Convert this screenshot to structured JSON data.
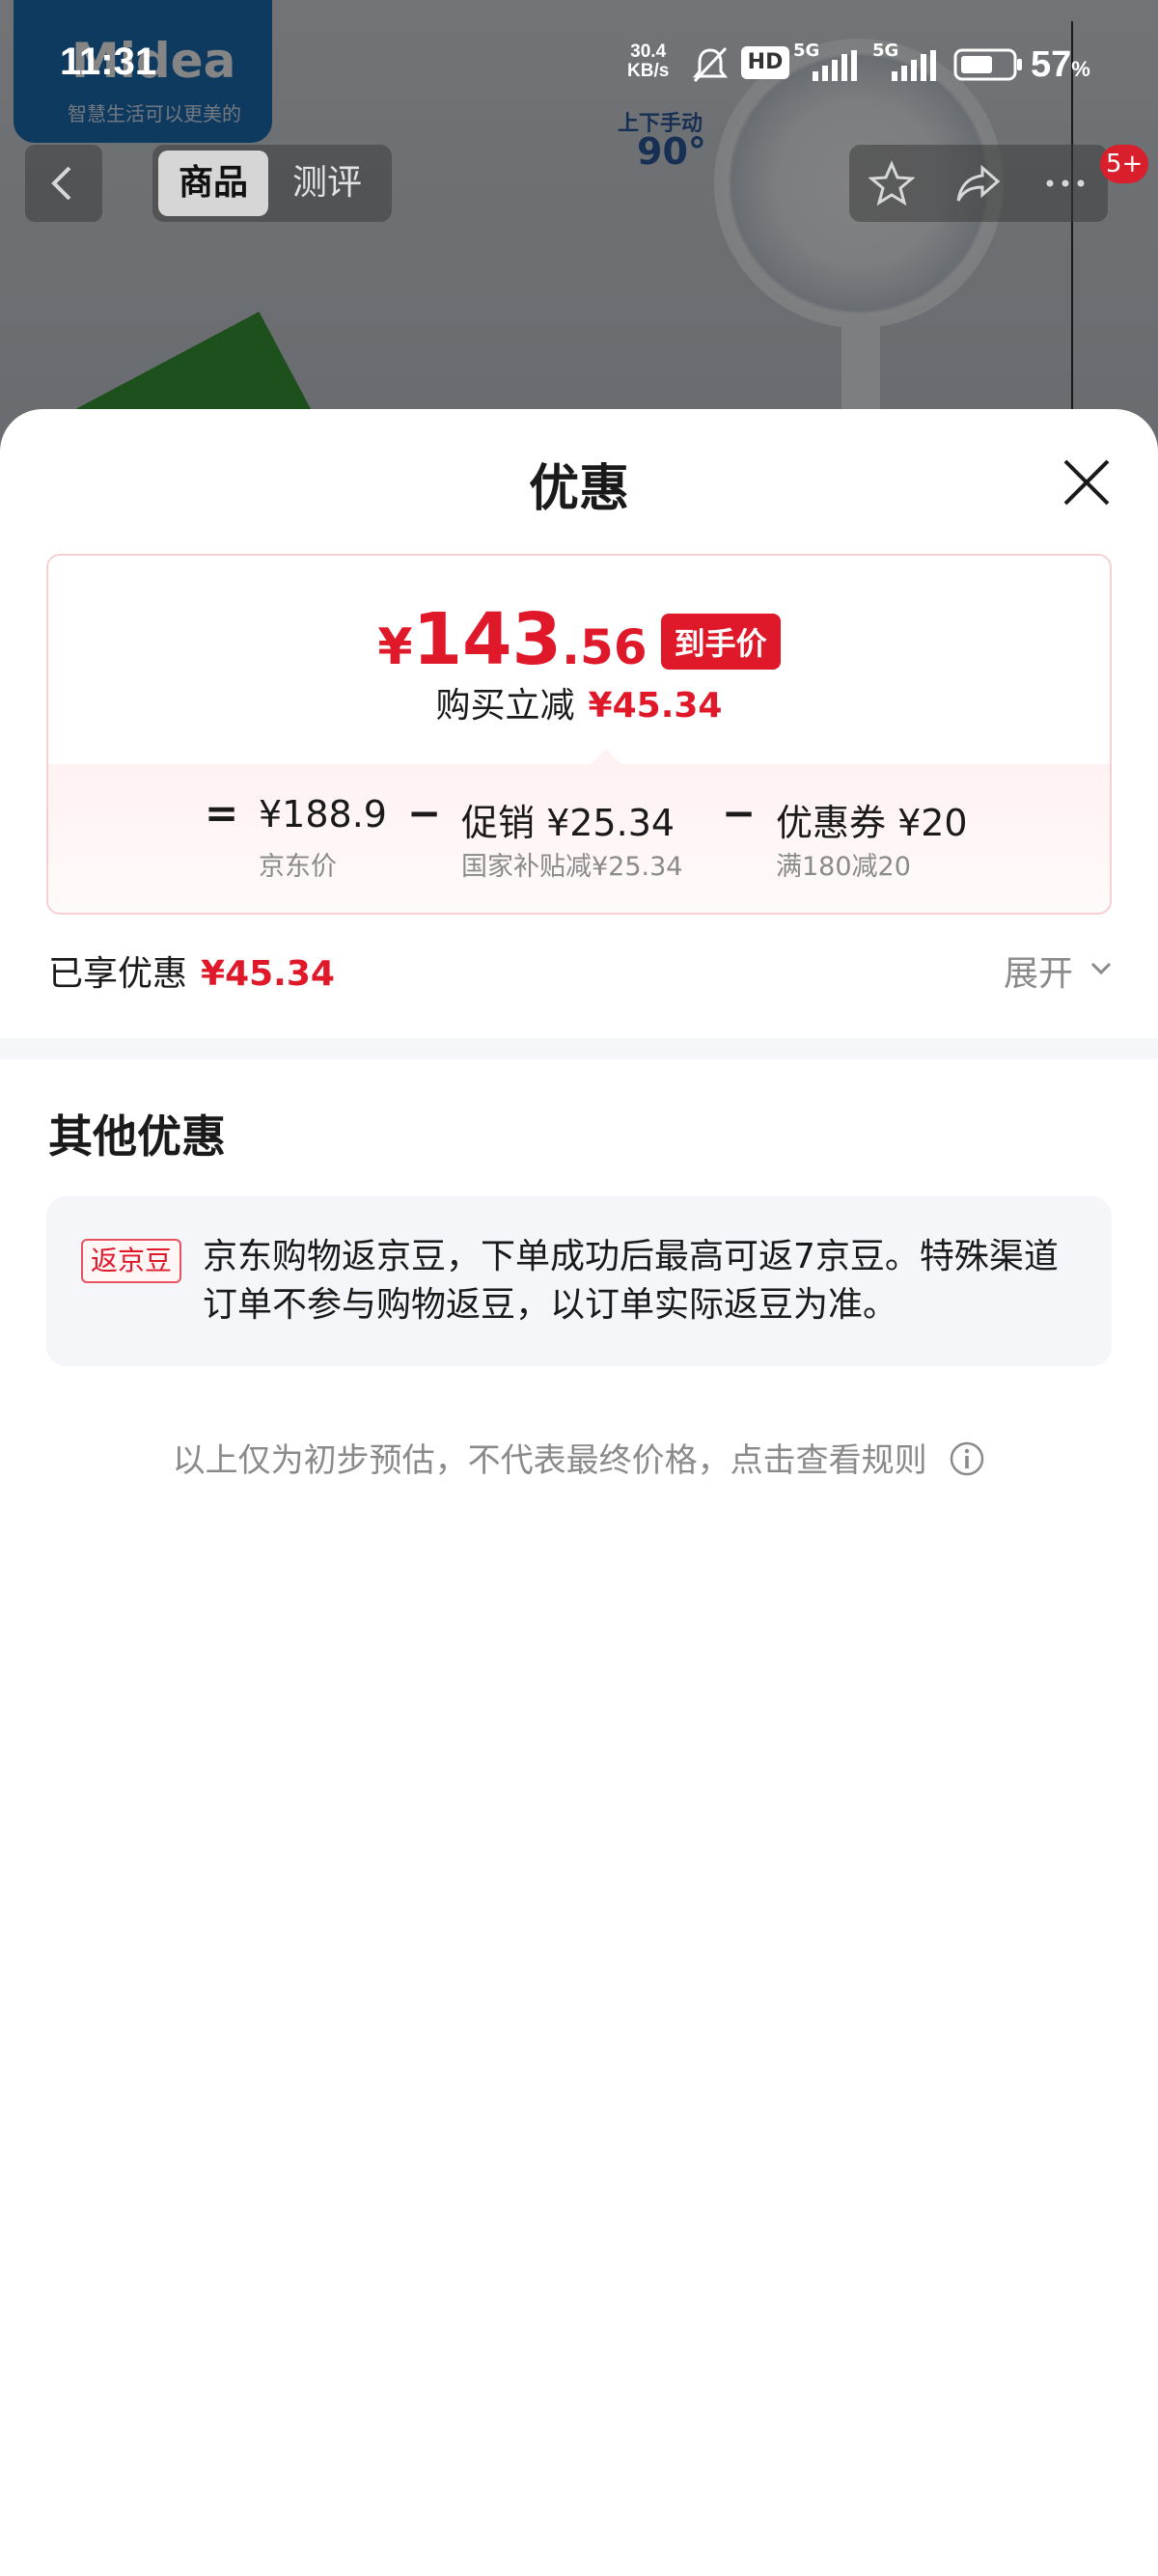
{
  "status_bar": {
    "time": "11:31",
    "net_speed_value": "30.4",
    "net_speed_unit": "KB/s",
    "battery_percent": "57",
    "battery_unit": "%",
    "hd_label": "HD",
    "sim1": "5G",
    "sim2": "5G"
  },
  "background": {
    "brand_logo": "Midea",
    "brand_slogan": "智慧生活可以更美的",
    "rotate_label": "上下手动",
    "rotate_degree": "90°",
    "tabs": [
      "商品",
      "测评"
    ],
    "badge": "5+"
  },
  "sheet": {
    "title": "优惠",
    "final_price": {
      "currency": "¥",
      "integer": "143",
      "decimal": ".56",
      "tag": "到手价"
    },
    "instant_discount_label": "购买立减",
    "instant_discount_amount": "¥45.34",
    "formula": {
      "equals": "=",
      "minus": "−",
      "jd_price": "¥188.9",
      "jd_price_label": "京东价",
      "promo": "促销 ¥25.34",
      "promo_desc": "国家补贴减¥25.34",
      "coupon": "优惠券 ¥20",
      "coupon_desc": "满180减20"
    },
    "enjoyed_label": "已享优惠",
    "enjoyed_amount": "¥45.34",
    "expand_label": "展开",
    "other_title": "其他优惠",
    "other_chip": "返京豆",
    "other_text": "京东购物返京豆，下单成功后最高可返7京豆。特殊渠道订单不参与购物返豆，以订单实际返豆为准。",
    "footnote": "以上仅为初步预估，不代表最终价格，点击查看规则"
  },
  "colors": {
    "accent_red": "#e0192a",
    "muted_text": "#8a8a8a",
    "card_bg": "#f5f6fa"
  }
}
